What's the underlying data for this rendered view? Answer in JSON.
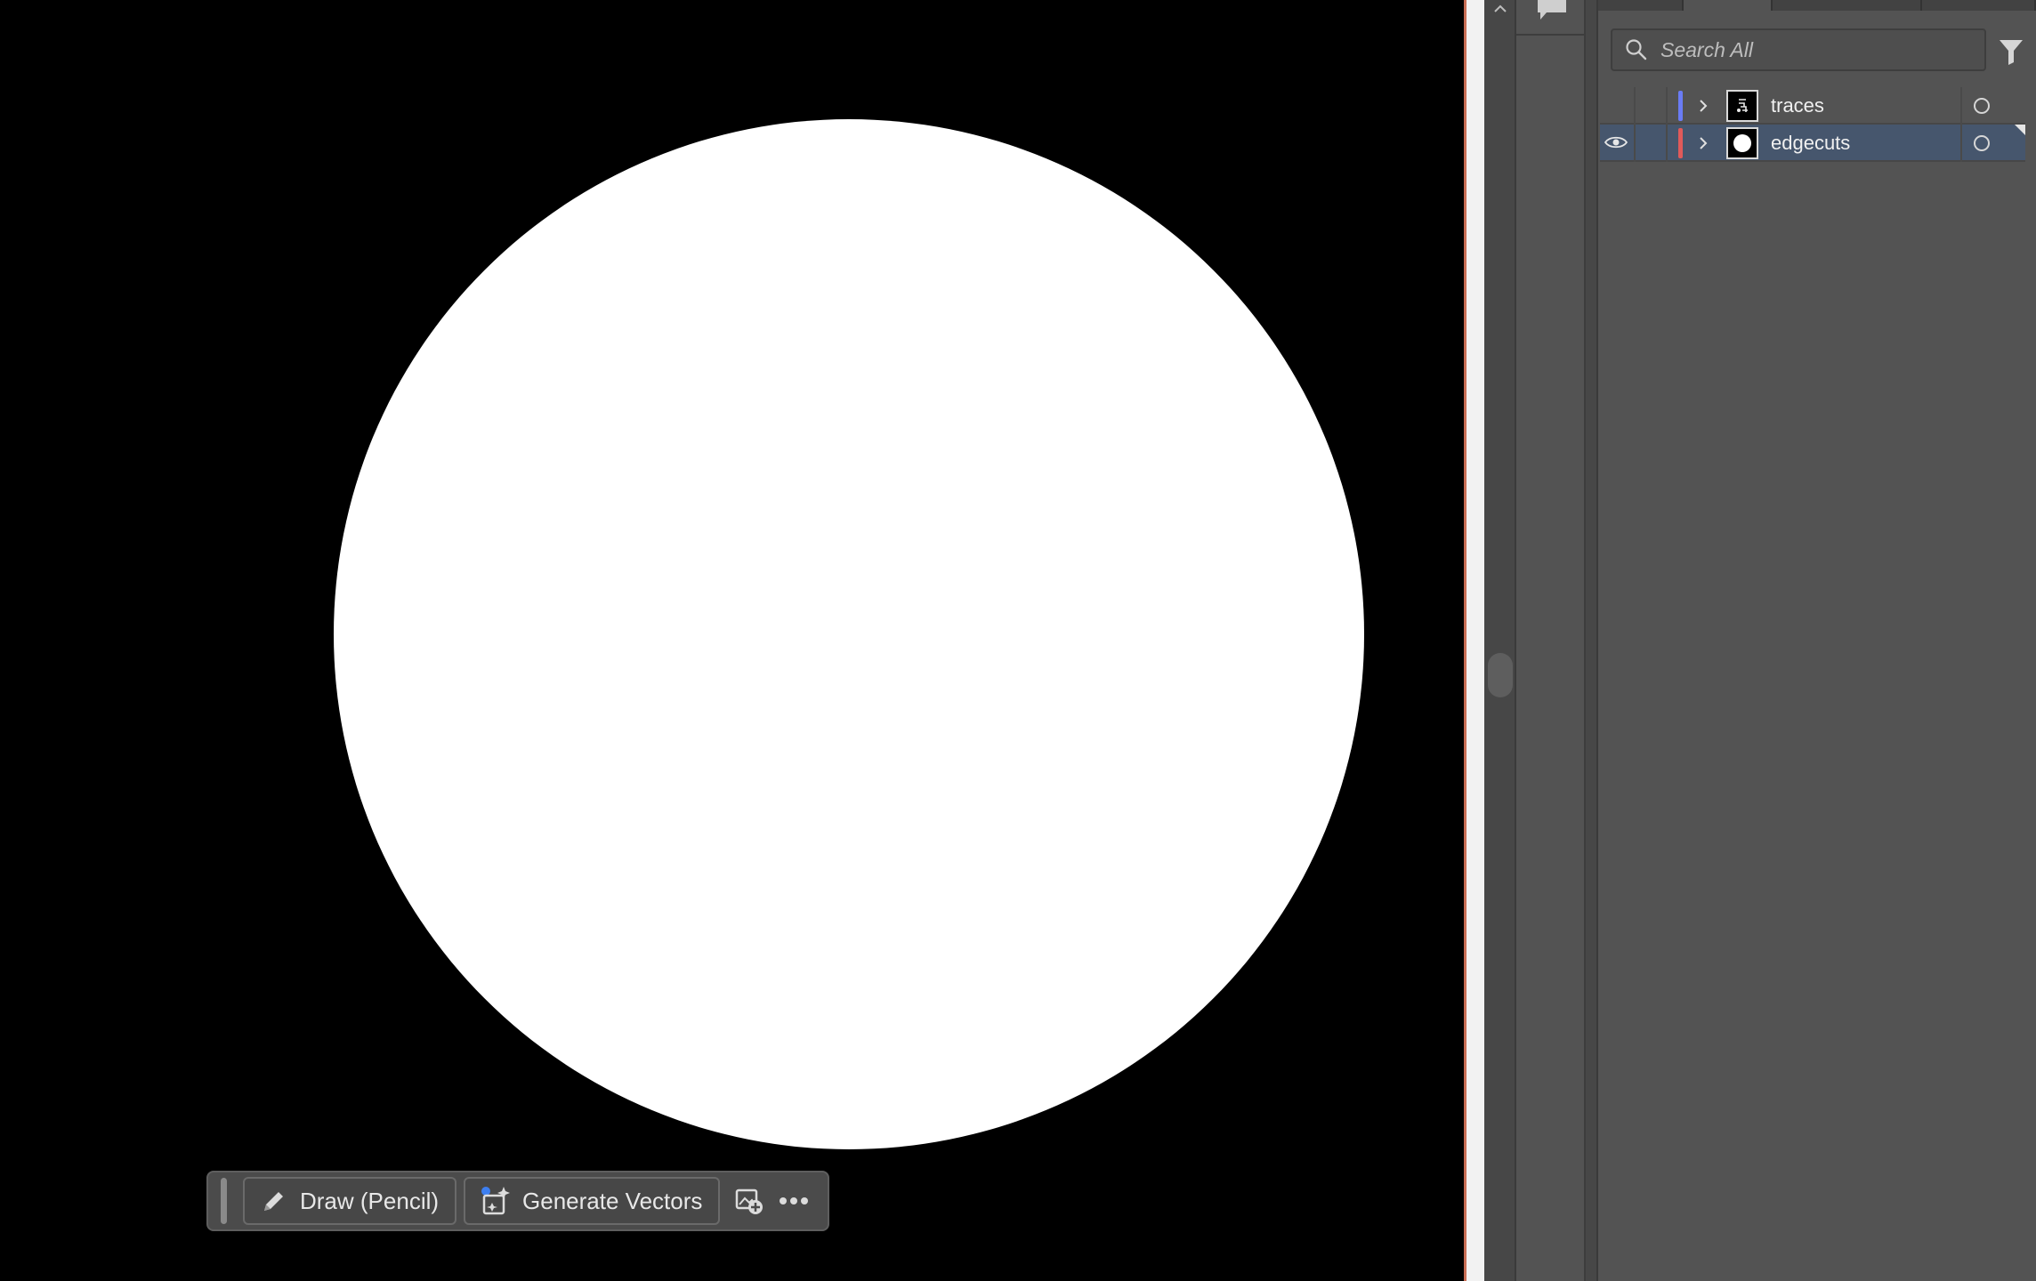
{
  "taskbar": {
    "draw_label": "Draw (Pencil)",
    "generate_label": "Generate Vectors",
    "icons": [
      "pencil-icon",
      "generate-vectors-icon",
      "place-image-icon",
      "more-icon"
    ]
  },
  "layers_panel": {
    "search": {
      "placeholder": "Search All"
    },
    "layers": [
      {
        "name": "traces",
        "color": "#6a7cf5",
        "visible": false,
        "selected": false
      },
      {
        "name": "edgecuts",
        "color": "#e05a5a",
        "visible": true,
        "selected": true
      }
    ]
  },
  "colors": {
    "canvas": "#000000",
    "artwork": "#ffffff",
    "panel": "#535353",
    "selection": "#46566d"
  }
}
